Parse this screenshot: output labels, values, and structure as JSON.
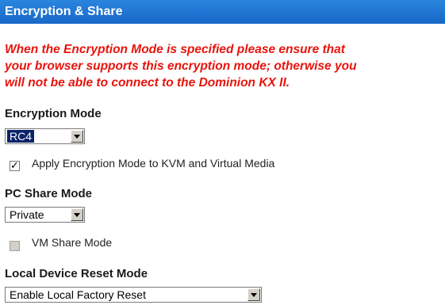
{
  "header": {
    "title": "Encryption & Share"
  },
  "warning": {
    "line1": "When the Encryption Mode is specified please ensure that",
    "line2": "your browser supports this encryption mode; otherwise you",
    "line3": "will not be able to connect to the Dominion KX II."
  },
  "encryption": {
    "label": "Encryption Mode",
    "value": "RC4",
    "apply_label": "Apply Encryption Mode to KVM and Virtual Media",
    "apply_checked": true
  },
  "pc_share": {
    "label": "PC Share Mode",
    "value": "Private",
    "vm_label": "VM Share Mode",
    "vm_checked": false,
    "vm_disabled": true
  },
  "reset": {
    "label": "Local Device Reset Mode",
    "value": "Enable Local Factory Reset"
  },
  "colors": {
    "header_bg": "#1f77d4",
    "warning": "#e8130c",
    "selected_bg": "#0a246a"
  }
}
